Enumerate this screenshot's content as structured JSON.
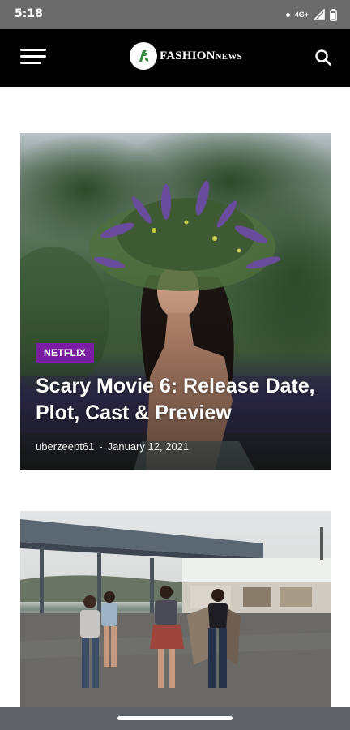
{
  "status_bar": {
    "time": "5:18",
    "network": "4G+",
    "icons": [
      "notification-dot-icon",
      "signal-icon",
      "battery-icon"
    ]
  },
  "header": {
    "logo_text_main": "FASHION",
    "logo_text_small": "NEWS",
    "icons": [
      "menu-icon",
      "logo-icon",
      "search-icon"
    ]
  },
  "articles": [
    {
      "category": "NETFLIX",
      "title": "Scary Movie 6: Release Date, Plot, Cast & Preview",
      "author": "uberzeept61",
      "separator": "-",
      "date": "January 12, 2021"
    }
  ],
  "colors": {
    "appbar": "#000000",
    "statusbar": "#6b6b6b",
    "category_badge": "#7a1ea1",
    "logo_green": "#2e8b3a"
  }
}
